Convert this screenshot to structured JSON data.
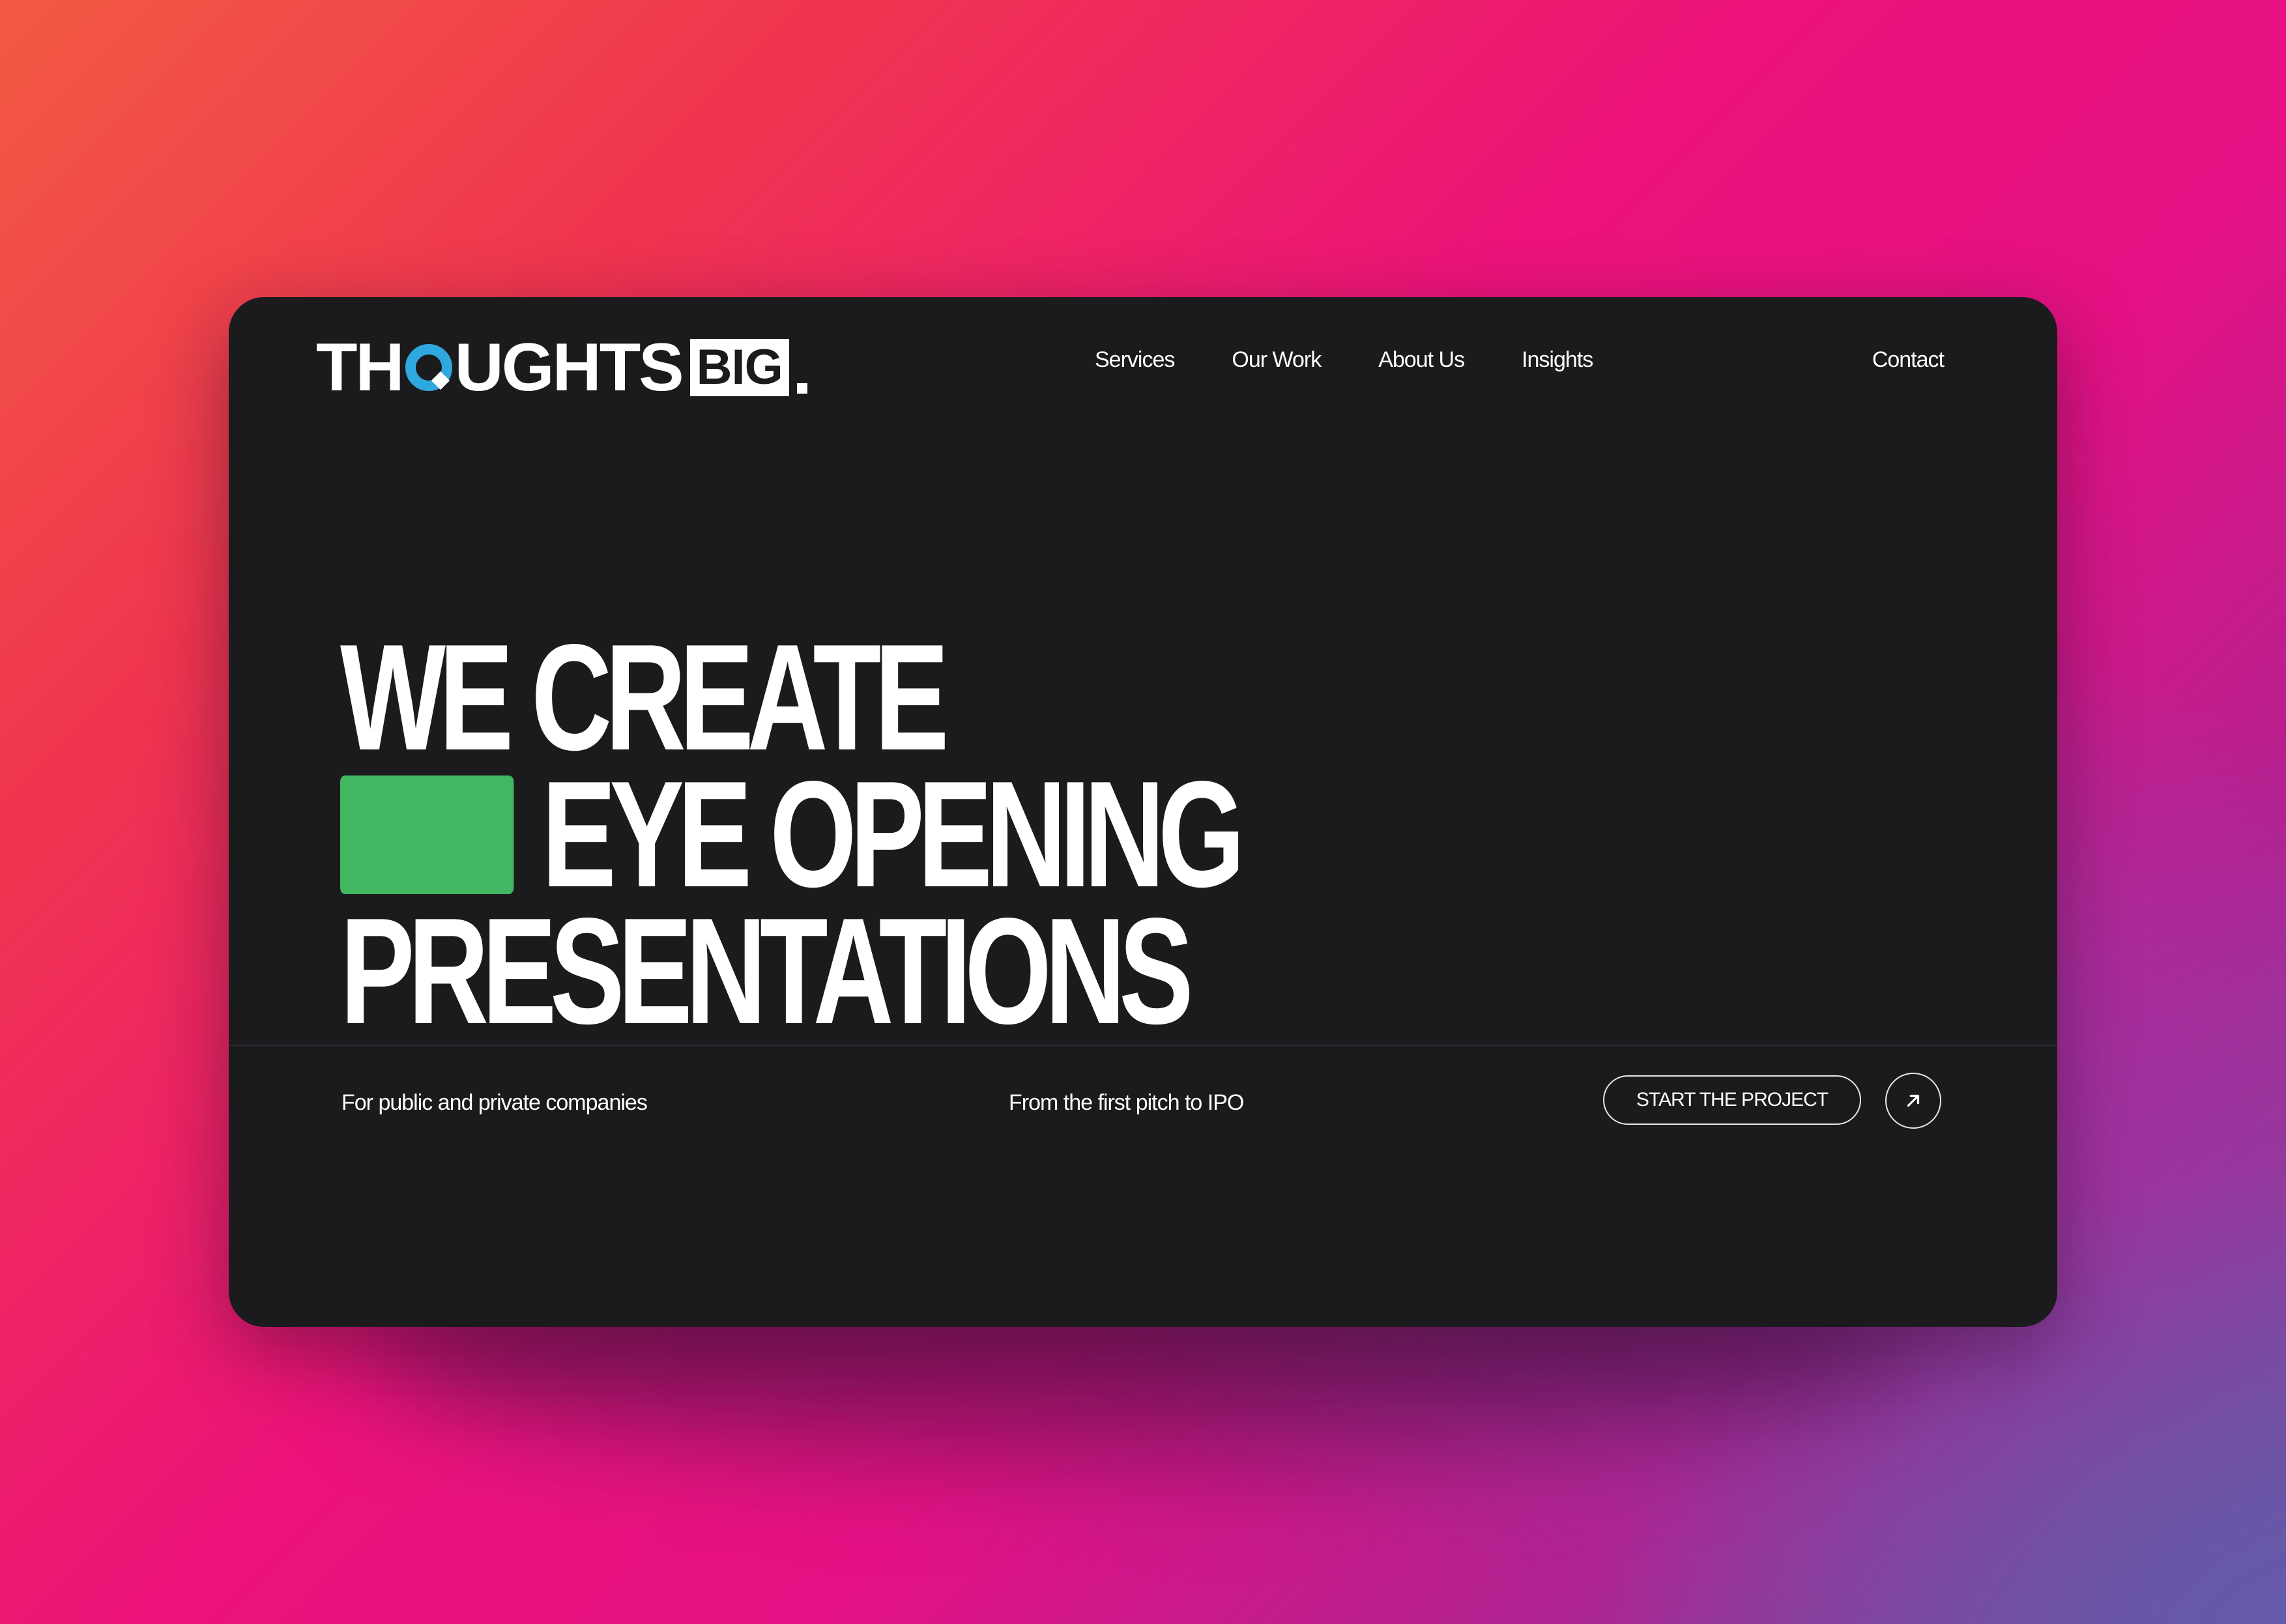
{
  "header": {
    "logo": {
      "part1": "TH",
      "part2": "UGHTS",
      "box": "BIG"
    },
    "nav": [
      {
        "label": "Services"
      },
      {
        "label": "Our Work"
      },
      {
        "label": "About Us"
      },
      {
        "label": "Insights"
      }
    ],
    "contact": "Contact"
  },
  "hero": {
    "line1": "WE CREATE",
    "line2": "EYE OPENING",
    "line3": "PRESENTATIONS",
    "swatch_color": "#41b762"
  },
  "footer": {
    "tagline_left": "For public and private companies",
    "tagline_mid": "From the first pitch to IPO",
    "cta_label": "START THE PROJECT",
    "arrow_icon": "arrow-up-right-icon"
  }
}
